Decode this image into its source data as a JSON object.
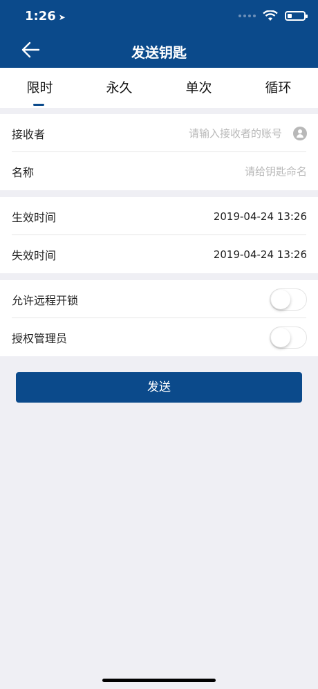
{
  "status": {
    "time": "1:26",
    "location_icon": "location-arrow-icon",
    "wifi_icon": "wifi-icon",
    "battery_level": 0.2
  },
  "header": {
    "title": "发送钥匙",
    "back_icon": "arrow-left-icon"
  },
  "tabs": [
    {
      "label": "限时",
      "active": true
    },
    {
      "label": "永久",
      "active": false
    },
    {
      "label": "单次",
      "active": false
    },
    {
      "label": "循环",
      "active": false
    }
  ],
  "recipient": {
    "label": "接收者",
    "placeholder": "请输入接收者的账号",
    "icon": "contact-icon"
  },
  "name": {
    "label": "名称",
    "placeholder": "请给钥匙命名"
  },
  "effective": {
    "label": "生效时间",
    "value": "2019-04-24 13:26"
  },
  "expire": {
    "label": "失效时间",
    "value": "2019-04-24 13:26"
  },
  "remote_unlock": {
    "label": "允许远程开锁",
    "on": false
  },
  "admin": {
    "label": "授权管理员",
    "on": false
  },
  "send_button": {
    "label": "发送"
  },
  "colors": {
    "primary": "#0b4a8b",
    "background": "#efeff4"
  }
}
